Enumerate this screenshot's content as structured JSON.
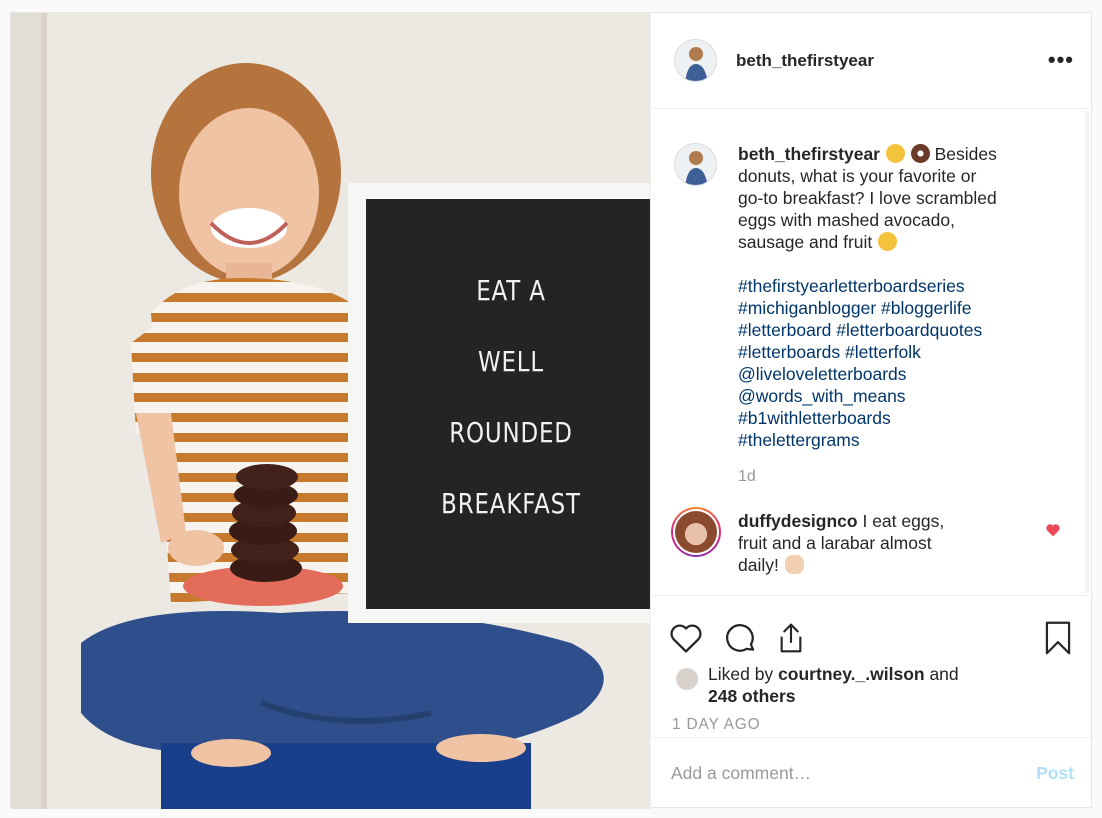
{
  "post": {
    "author": "beth_thefirstyear",
    "more_label": "•••",
    "photo": {
      "board_lines": [
        "EAT  A",
        "WELL",
        "ROUNDED",
        "BREAKFAST"
      ]
    },
    "caption": {
      "author": "beth_thefirstyear",
      "text_lines": [
        "Besides",
        "donuts, what is your favorite or",
        "go-to breakfast? I love scrambled",
        "eggs with mashed avocado,",
        "sausage and fruit"
      ],
      "emojis": [
        "rolling-laughing-emoji",
        "donut-emoji",
        "heart-eyes-emoji"
      ],
      "hashtags": [
        "#thefirstyearletterboardseries",
        "#michiganblogger #bloggerlife",
        "#letterboard #letterboardquotes",
        "#letterboards #letterfolk",
        "@liveloveletterboards",
        "@words_with_means",
        "#b1withletterboards",
        "#thelettergrams"
      ],
      "age": "1d"
    },
    "comment": {
      "author": "duffydesignco",
      "text_line1": "I eat eggs,",
      "text_line2": "fruit and a larabar almost",
      "text_line3": "daily!",
      "emoji": "ok-hand-emoji"
    },
    "likes": {
      "prefix": "Liked by",
      "user": "courtney._.wilson",
      "and": "and",
      "others": "248 others"
    },
    "timestamp": "1 DAY AGO",
    "comment_box": {
      "placeholder": "Add a comment…",
      "post_label": "Post"
    },
    "icons": [
      "heart-icon",
      "comment-icon",
      "share-icon",
      "bookmark-icon"
    ],
    "colors": {
      "link": "#003569",
      "muted": "#999999",
      "post_disabled": "#b2dffc",
      "like_red": "#ed4956"
    }
  }
}
